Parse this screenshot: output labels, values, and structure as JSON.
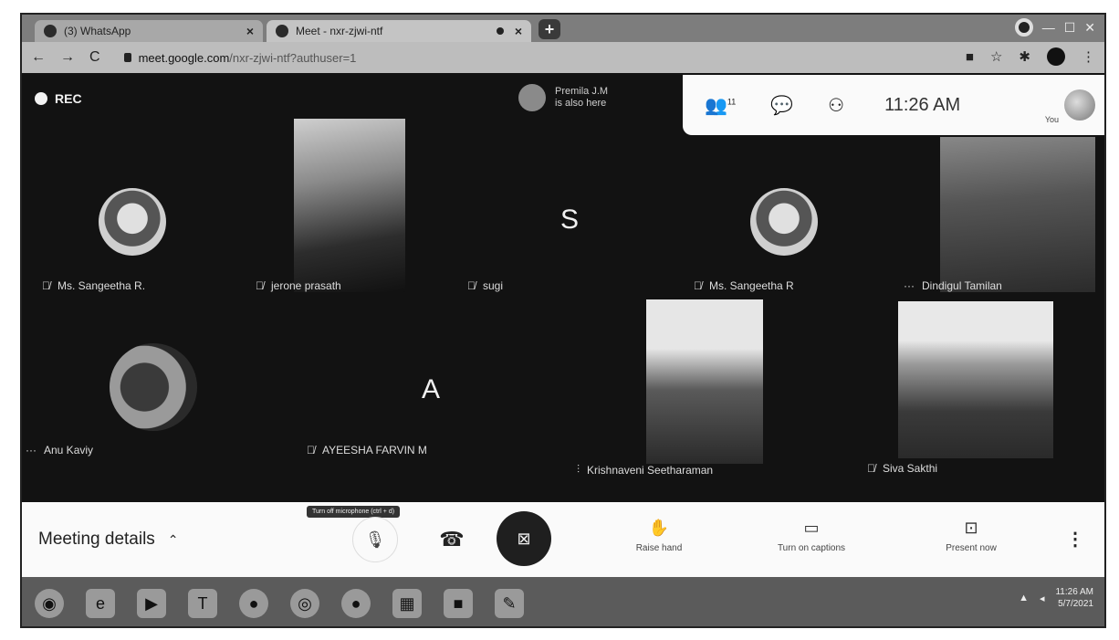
{
  "browser": {
    "tabs": [
      {
        "title": "(3) WhatsApp",
        "icon": "whatsapp-icon"
      },
      {
        "title": "Meet - nxr-zjwi-ntf",
        "icon": "meet-icon"
      }
    ],
    "new_tab": "+",
    "url_host": "meet.google.com",
    "url_path": "/nxr-zjwi-ntf?authuser=1"
  },
  "meet": {
    "recording_label": "REC",
    "notification": {
      "name": "Premila J.M",
      "message": "is also here"
    },
    "participants_count": "11",
    "time": "11:26 AM",
    "self_label": "You",
    "tiles": [
      {
        "name": "Ms. Sangeetha R.",
        "type": "avatar",
        "muted": true
      },
      {
        "name": "jerone prasath",
        "type": "video",
        "muted": true
      },
      {
        "name": "sugi",
        "type": "letter",
        "letter": "S",
        "muted": true
      },
      {
        "name": "Ms. Sangeetha R",
        "type": "avatar",
        "muted": true
      },
      {
        "name": "Dindigul Tamilan",
        "type": "video",
        "muted": false
      },
      {
        "name": "Anu Kaviy",
        "type": "avatar",
        "muted": false
      },
      {
        "name": "AYEESHA FARVIN M",
        "type": "letter",
        "letter": "A",
        "muted": true
      },
      {
        "name": "Krishnaveni Seetharaman",
        "type": "video",
        "muted": false
      },
      {
        "name": "Siva Sakthi",
        "type": "video",
        "muted": true
      }
    ]
  },
  "controls": {
    "meeting_details": "Meeting details",
    "tooltip": "Turn off microphone (ctrl + d)",
    "raise_hand": "Raise hand",
    "captions": "Turn on captions",
    "present": "Present now"
  },
  "taskbar": {
    "time": "11:26 AM",
    "date": "5/7/2021"
  }
}
